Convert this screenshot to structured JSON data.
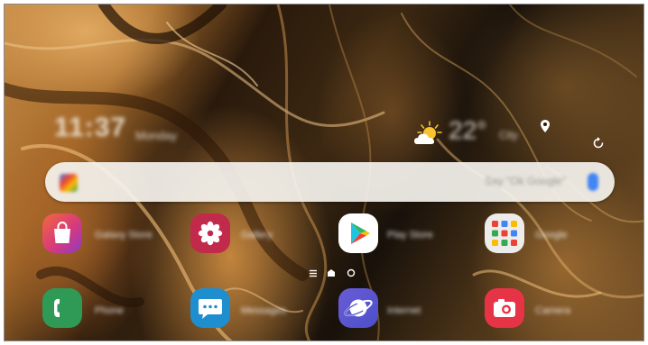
{
  "home": {
    "clock_text": "11:37",
    "date_text": "Monday",
    "weather_temp": "22°",
    "weather_place": "City"
  },
  "search": {
    "placeholder": "Say \"Ok Google\""
  },
  "apps": {
    "row1": [
      {
        "label": "Galaxy Store",
        "icon": "shopping-bag-icon"
      },
      {
        "label": "Gallery",
        "icon": "flower-icon"
      },
      {
        "label": "Play Store",
        "icon": "play-triangle-icon"
      },
      {
        "label": "Google",
        "icon": "folder-grid-icon"
      }
    ],
    "row2": [
      {
        "label": "Phone",
        "icon": "phone-handset-icon"
      },
      {
        "label": "Messages",
        "icon": "chat-bubble-icon"
      },
      {
        "label": "Internet",
        "icon": "planet-icon"
      },
      {
        "label": "Camera",
        "icon": "camera-icon"
      }
    ]
  },
  "colors": {
    "store": "#e0436a",
    "gallery": "#c12a4a",
    "phone": "#2f9a56",
    "messages": "#1f8ecf",
    "internet": "#4b4fc9",
    "camera": "#e63346"
  }
}
